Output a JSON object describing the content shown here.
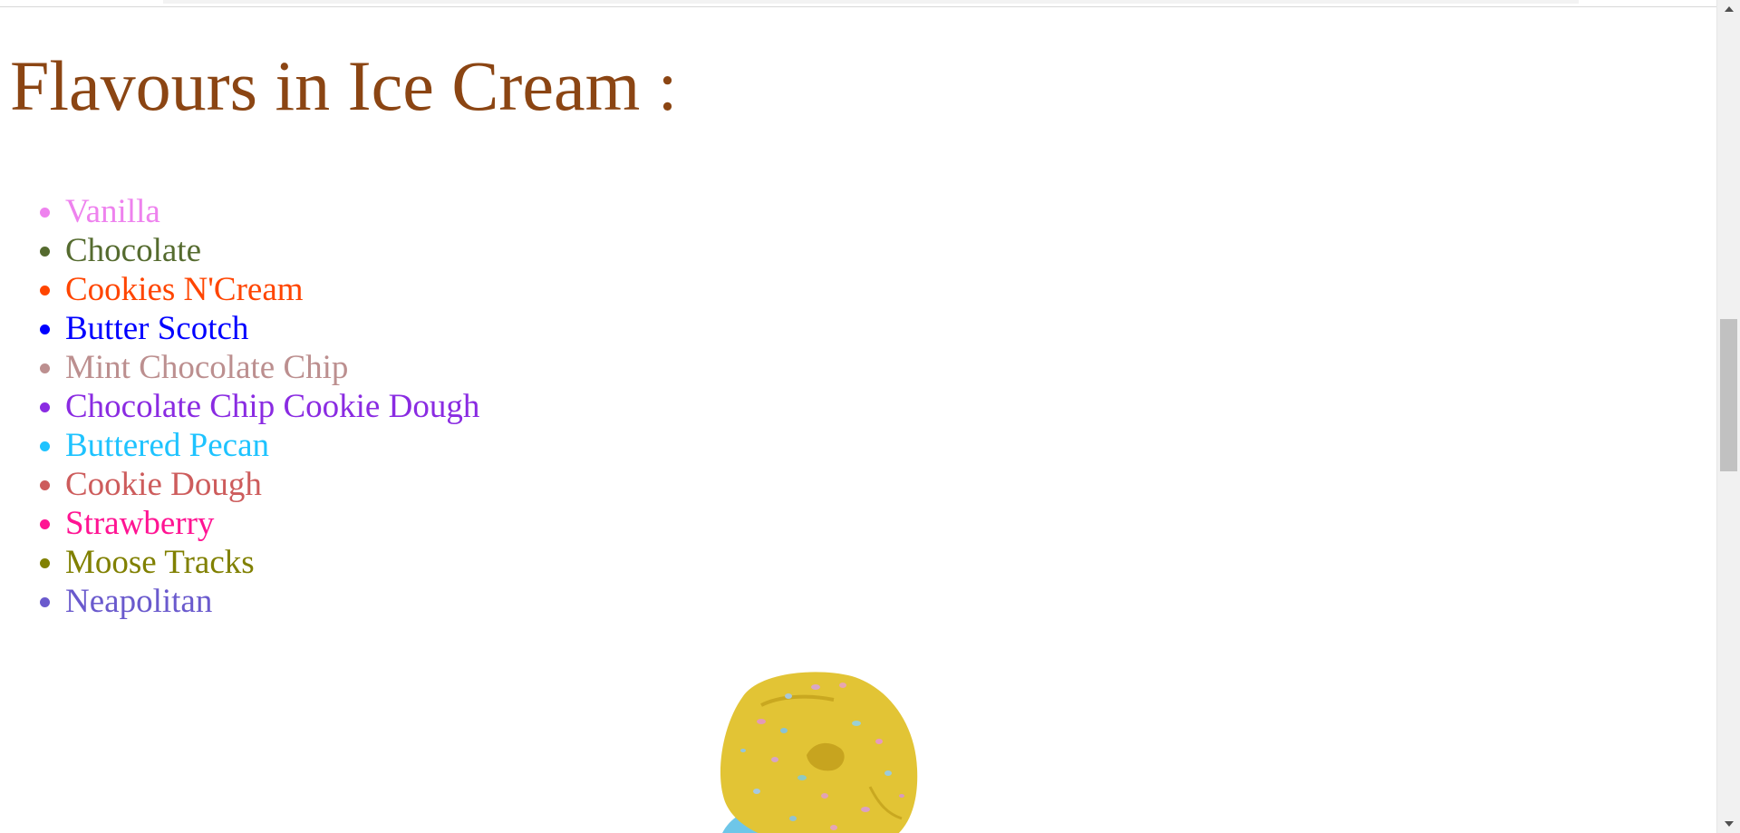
{
  "page": {
    "title": "Flavours in Ice Cream :"
  },
  "flavours": [
    {
      "label": "Vanilla",
      "color": "#ee82ee"
    },
    {
      "label": "Chocolate",
      "color": "#556b2f"
    },
    {
      "label": "Cookies N'Cream",
      "color": "#ff4500"
    },
    {
      "label": "Butter Scotch",
      "color": "#0000ff"
    },
    {
      "label": "Mint Chocolate Chip",
      "color": "#bc8f8f"
    },
    {
      "label": "Chocolate Chip Cookie Dough",
      "color": "#8a2be2"
    },
    {
      "label": "Buttered Pecan",
      "color": "#1ec3ff"
    },
    {
      "label": "Cookie Dough",
      "color": "#cd5c5c"
    },
    {
      "label": "Strawberry",
      "color": "#ff1493"
    },
    {
      "label": "Moose Tracks",
      "color": "#808000"
    },
    {
      "label": "Neapolitan",
      "color": "#6a5acd"
    }
  ],
  "colors": {
    "title": "#8b4513",
    "background": "#ffffff",
    "scrollbar_track": "#f1f1f1",
    "scrollbar_thumb": "#c1c1c1"
  },
  "icons": {
    "scroll_up": "triangle-up-icon",
    "scroll_down": "triangle-down-icon"
  }
}
